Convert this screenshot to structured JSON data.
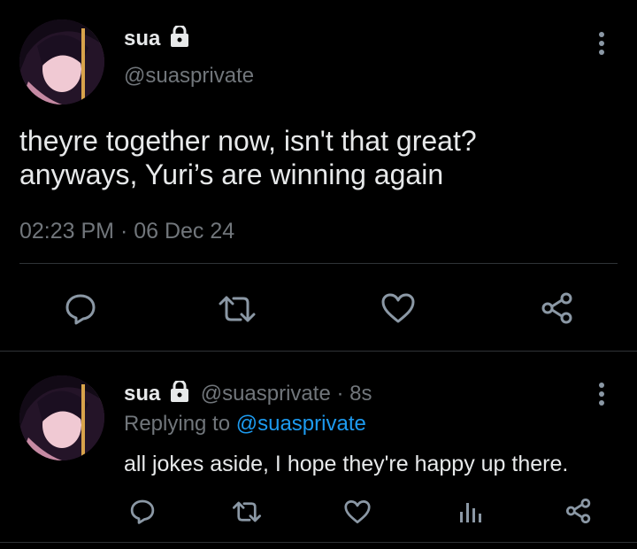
{
  "main_tweet": {
    "display_name": "sua",
    "handle": "@suasprivate",
    "text_line1": "theyre together now, isn't that great?",
    "text_line2": "anyways, Yuri’s are winning again",
    "timestamp": "02:23 PM · 06 Dec 24",
    "icons": [
      "reply-icon",
      "retweet-icon",
      "like-icon",
      "share-icon"
    ]
  },
  "reply": {
    "display_name": "sua",
    "handle": "@suasprivate",
    "time_sep": "·",
    "time": "8s",
    "replying_prefix": "Replying to",
    "replying_to": "@suasprivate",
    "text": "all jokes aside, I hope they're happy up there.",
    "icons": [
      "reply-icon",
      "retweet-icon",
      "like-icon",
      "analytics-icon",
      "share-icon"
    ]
  },
  "colors": {
    "background": "#000000",
    "text": "#e7e9ea",
    "muted": "#71767b",
    "link": "#1d9bf0",
    "divider": "#2f3336"
  }
}
